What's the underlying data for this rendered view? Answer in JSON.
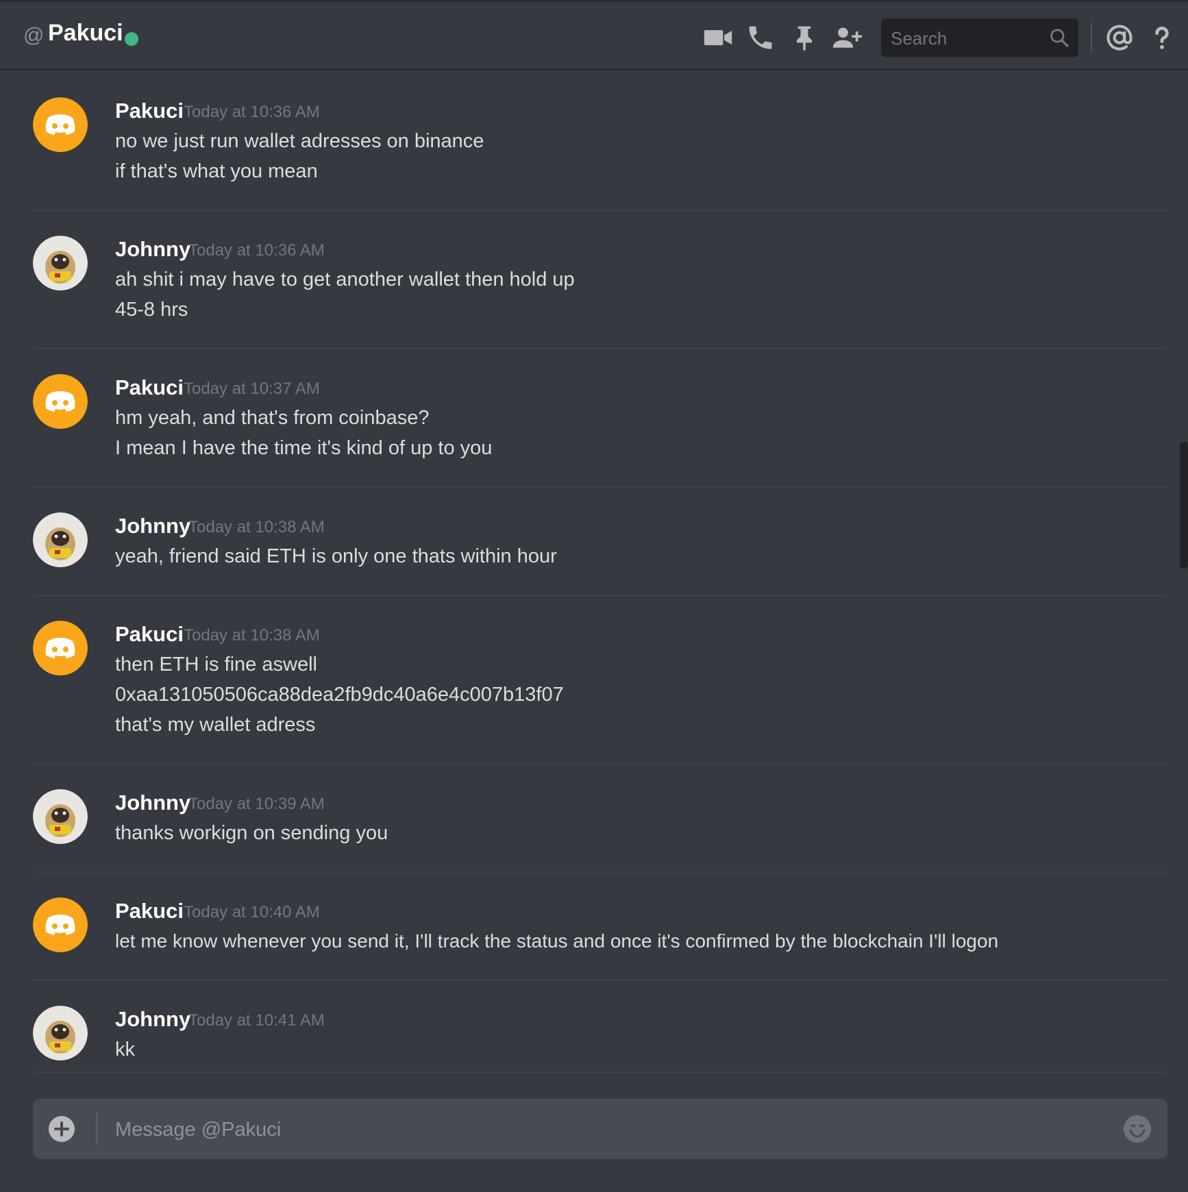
{
  "header": {
    "at_symbol": "@",
    "channel_name": "Pakuci",
    "status": "online",
    "status_color": "#43b581",
    "icons": [
      "video-call-icon",
      "voice-call-icon",
      "pin-icon",
      "add-friend-icon",
      "mention-icon",
      "help-icon"
    ]
  },
  "search": {
    "placeholder": "Search"
  },
  "messages": [
    {
      "author": "Pakuci",
      "avatar": "discord-default-avatar",
      "timestamp": "Today at 10:36 AM",
      "lines": [
        "no we just run wallet adresses on binance",
        "if that's what you mean"
      ]
    },
    {
      "author": "Johnny",
      "avatar": "pug-avatar",
      "timestamp": "Today at 10:36 AM",
      "lines": [
        "ah shit i may have to get another wallet then hold up",
        "45-8 hrs"
      ]
    },
    {
      "author": "Pakuci",
      "avatar": "discord-default-avatar",
      "timestamp": "Today at 10:37 AM",
      "lines": [
        "hm yeah, and that's from coinbase?",
        "I mean I have the time it's kind of up to you"
      ]
    },
    {
      "author": "Johnny",
      "avatar": "pug-avatar",
      "timestamp": "Today at 10:38 AM",
      "lines": [
        "yeah, friend said ETH is only one thats within hour"
      ]
    },
    {
      "author": "Pakuci",
      "avatar": "discord-default-avatar",
      "timestamp": "Today at 10:38 AM",
      "lines": [
        "then ETH is fine aswell",
        "0xaa131050506ca88dea2fb9dc40a6e4c007b13f07",
        "that's my wallet adress"
      ]
    },
    {
      "author": "Johnny",
      "avatar": "pug-avatar",
      "timestamp": "Today at 10:39 AM",
      "lines": [
        "thanks workign on sending you"
      ]
    },
    {
      "author": "Pakuci",
      "avatar": "discord-default-avatar",
      "timestamp": "Today at 10:40 AM",
      "lines": [
        "let me know whenever you send it, I'll track the status and once it's confirmed by the blockchain I'll logon"
      ]
    },
    {
      "author": "Johnny",
      "avatar": "pug-avatar",
      "timestamp": "Today at 10:41 AM",
      "lines": [
        "kk"
      ]
    }
  ],
  "composer": {
    "placeholder": "Message @Pakuci"
  },
  "colors": {
    "background": "#36393f",
    "discord_avatar_bg": "#faa61a",
    "text_primary": "#dcddde",
    "timestamp": "#72767d"
  }
}
